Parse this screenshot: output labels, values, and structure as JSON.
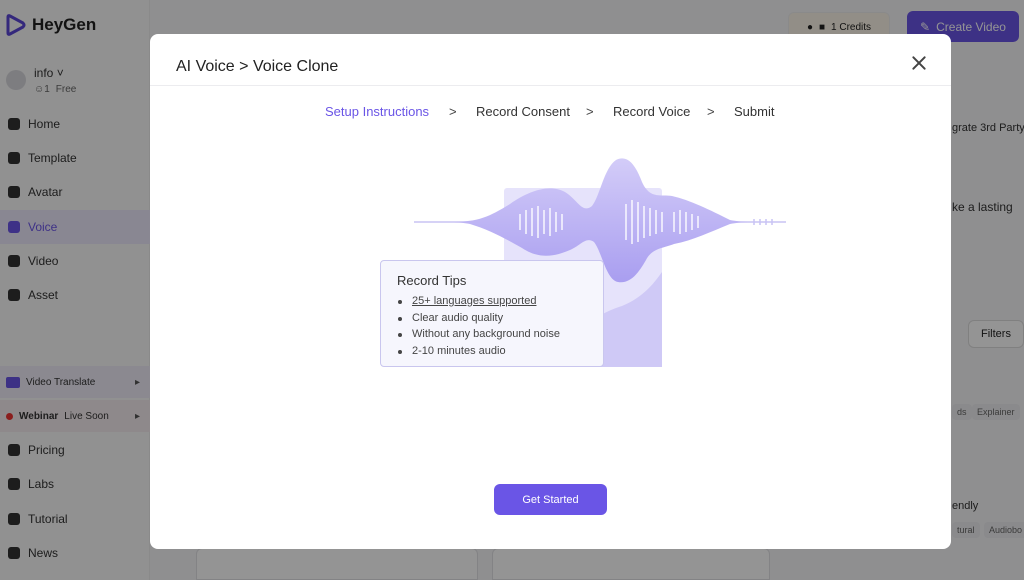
{
  "app": {
    "brand": "HeyGen",
    "user": {
      "name": "info",
      "members": "1",
      "plan": "Free"
    },
    "credits": "1 Credits",
    "create_label": "Create Video"
  },
  "sidebar": {
    "items": [
      {
        "label": "Home",
        "icon": "home-icon"
      },
      {
        "label": "Template",
        "icon": "template-icon"
      },
      {
        "label": "Avatar",
        "icon": "avatar-icon"
      },
      {
        "label": "Voice",
        "icon": "voice-icon",
        "active": true
      },
      {
        "label": "Video",
        "icon": "video-icon"
      },
      {
        "label": "Asset",
        "icon": "asset-icon"
      }
    ],
    "video_translate": "Video Translate",
    "webinar": "Webinar",
    "webinar_status": "Live Soon",
    "bottom": [
      {
        "label": "Pricing",
        "icon": "pricing-icon"
      },
      {
        "label": "Labs",
        "icon": "labs-icon"
      },
      {
        "label": "Tutorial",
        "icon": "tutorial-icon"
      },
      {
        "label": "News",
        "icon": "news-icon"
      }
    ]
  },
  "background": {
    "integrate": "grate 3rd Party",
    "lasting": "ke a lasting",
    "filters": "Filters",
    "chip_ds": "ds",
    "chip_explainer": "Explainer",
    "friendly": "endly",
    "chip_tural": "tural",
    "chip_audiobo": "Audiobo"
  },
  "modal": {
    "title": "AI Voice > Voice Clone",
    "steps": [
      "Setup Instructions",
      "Record Consent",
      "Record Voice",
      "Submit"
    ],
    "step_separator": ">",
    "current_step": 0,
    "tips": {
      "title": "Record Tips",
      "items": [
        "25+ languages supported",
        "Clear audio quality",
        "Without any background noise",
        "2-10 minutes audio"
      ]
    },
    "cta": "Get Started"
  },
  "colors": {
    "accent": "#6a55e6",
    "wave": "#b9b0f2",
    "panel": "#e4e1fb"
  }
}
